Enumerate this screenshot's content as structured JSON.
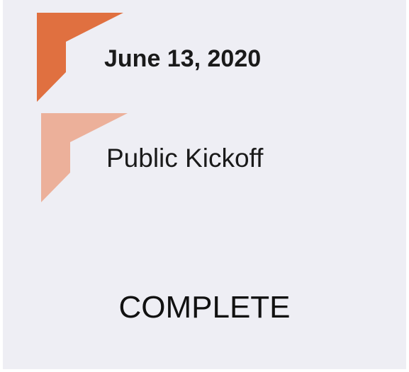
{
  "milestone": {
    "date": "June 13, 2020",
    "event": "Public Kickoff",
    "status": "COMPLETE"
  },
  "colors": {
    "background": "#eeeef4",
    "accent_primary": "#e07040",
    "accent_secondary": "#ecb09a",
    "text": "#1a1a1a"
  },
  "icons": {
    "date_marker": "corner-chevron-icon",
    "event_marker": "corner-chevron-icon"
  }
}
